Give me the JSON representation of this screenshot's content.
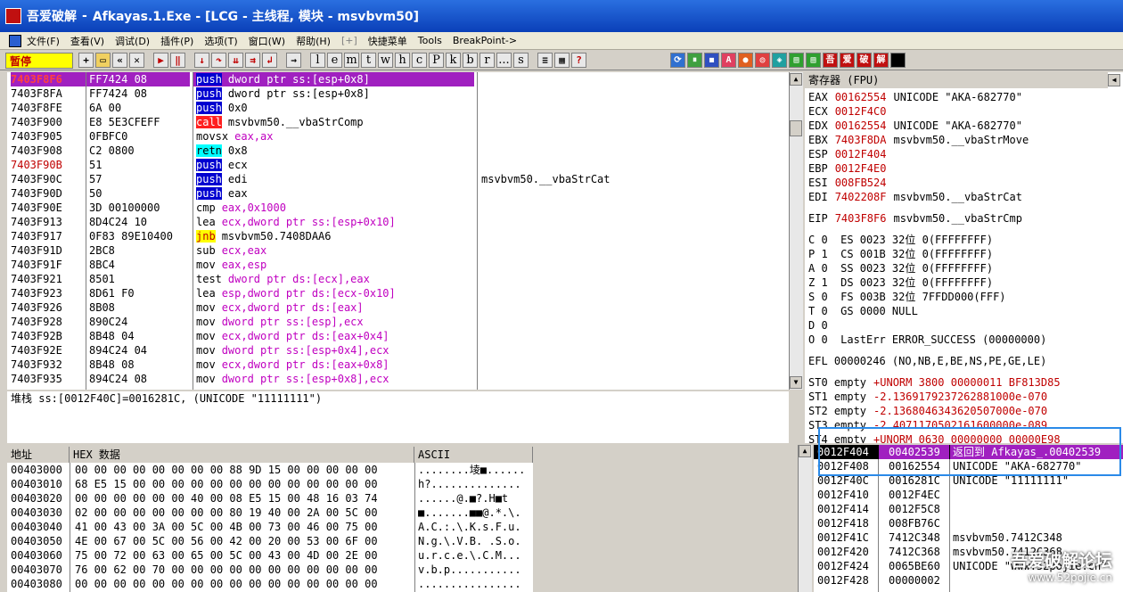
{
  "window": {
    "app_label": "吾爱破解",
    "title": "Afkayas.1.Exe - [LCG - 主线程, 模块 - msvbvm50]"
  },
  "menu": [
    "文件(F)",
    "查看(V)",
    "调试(D)",
    "插件(P)",
    "选项(T)",
    "窗口(W)",
    "帮助(H)",
    "[+]",
    "快捷菜单",
    "Tools",
    "BreakPoint->"
  ],
  "toolbar": {
    "status": "暂停",
    "letters": [
      "l",
      "e",
      "m",
      "t",
      "w",
      "h",
      "c",
      "P",
      "k",
      "b",
      "r",
      "...",
      "s"
    ],
    "right_labels": [
      "吾",
      "爱",
      "破",
      "解"
    ]
  },
  "disasm": [
    {
      "addr": "7403F8F6",
      "hex": "FF7424 08",
      "op": "push",
      "args": "dword ptr ss:[esp+0x8]",
      "cmt": "",
      "selected": true
    },
    {
      "addr": "7403F8FA",
      "hex": "FF7424 08",
      "op": "push",
      "args": "dword ptr ss:[esp+0x8]",
      "cmt": ""
    },
    {
      "addr": "7403F8FE",
      "hex": "6A 00",
      "op": "push",
      "args": "0x0",
      "cmt": ""
    },
    {
      "addr": "7403F900",
      "hex": "E8 5E3CFEFF",
      "op": "call",
      "args": "msvbvm50.__vbaStrComp",
      "cmt": ""
    },
    {
      "addr": "7403F905",
      "hex": "0FBFC0",
      "op": "movsx",
      "args": "eax,ax",
      "cmt": ""
    },
    {
      "addr": "7403F908",
      "hex": "C2 0800",
      "op": "retn",
      "args": "0x8",
      "cmt": ""
    },
    {
      "addr": "7403F90B",
      "hex": "51",
      "op": "push",
      "args": "ecx",
      "cmt": "",
      "redaddr": true
    },
    {
      "addr": "7403F90C",
      "hex": "57",
      "op": "push",
      "args": "edi",
      "cmt": "msvbvm50.__vbaStrCat"
    },
    {
      "addr": "7403F90D",
      "hex": "50",
      "op": "push",
      "args": "eax",
      "cmt": ""
    },
    {
      "addr": "7403F90E",
      "hex": "3D 00100000",
      "op": "cmp",
      "args": "eax,0x1000",
      "cmt": ""
    },
    {
      "addr": "7403F913",
      "hex": "8D4C24 10",
      "op": "lea",
      "args": "ecx,dword ptr ss:[esp+0x10]",
      "cmt": ""
    },
    {
      "addr": "7403F917",
      "hex": "0F83 89E10400",
      "op": "jnb",
      "args": "msvbvm50.7408DAA6",
      "cmt": ""
    },
    {
      "addr": "7403F91D",
      "hex": "2BC8",
      "op": "sub",
      "args": "ecx,eax",
      "cmt": ""
    },
    {
      "addr": "7403F91F",
      "hex": "8BC4",
      "op": "mov",
      "args": "eax,esp",
      "cmt": ""
    },
    {
      "addr": "7403F921",
      "hex": "8501",
      "op": "test",
      "args": "dword ptr ds:[ecx],eax",
      "cmt": ""
    },
    {
      "addr": "7403F923",
      "hex": "8D61 F0",
      "op": "lea",
      "args": "esp,dword ptr ds:[ecx-0x10]",
      "cmt": ""
    },
    {
      "addr": "7403F926",
      "hex": "8B08",
      "op": "mov",
      "args": "ecx,dword ptr ds:[eax]",
      "cmt": ""
    },
    {
      "addr": "7403F928",
      "hex": "890C24",
      "op": "mov",
      "args": "dword ptr ss:[esp],ecx",
      "cmt": ""
    },
    {
      "addr": "7403F92B",
      "hex": "8B48 04",
      "op": "mov",
      "args": "ecx,dword ptr ds:[eax+0x4]",
      "cmt": ""
    },
    {
      "addr": "7403F92E",
      "hex": "894C24 04",
      "op": "mov",
      "args": "dword ptr ss:[esp+0x4],ecx",
      "cmt": ""
    },
    {
      "addr": "7403F932",
      "hex": "8B48 08",
      "op": "mov",
      "args": "ecx,dword ptr ds:[eax+0x8]",
      "cmt": ""
    },
    {
      "addr": "7403F935",
      "hex": "894C24 08",
      "op": "mov",
      "args": "dword ptr ss:[esp+0x8],ecx",
      "cmt": ""
    }
  ],
  "info_line": "堆栈 ss:[0012F40C]=0016281C, (UNICODE \"11111111\")",
  "dump": {
    "headers": [
      "地址",
      "HEX 数据",
      "ASCII"
    ],
    "rows": [
      {
        "addr": "00403000",
        "hex": "00 00 00 00 00 00 00 00 88 9D 15 00 00 00 00 00",
        "ascii": "........堎■......"
      },
      {
        "addr": "00403010",
        "hex": "68 E5 15 00 00 00 00 00 00 00 00 00 00 00 00 00",
        "ascii": "h?.............."
      },
      {
        "addr": "00403020",
        "hex": "00 00 00 00 00 00 40 00 08 E5 15 00 48 16 03 74",
        "ascii": "......@.■?.H■t"
      },
      {
        "addr": "00403030",
        "hex": "02 00 00 00 00 00 00 00 80 19 40 00 2A 00 5C 00",
        "ascii": "■.......■■@.*.\\."
      },
      {
        "addr": "00403040",
        "hex": "41 00 43 00 3A 00 5C 00 4B 00 73 00 46 00 75 00",
        "ascii": "A.C.:.\\.K.s.F.u."
      },
      {
        "addr": "00403050",
        "hex": "4E 00 67 00 5C 00 56 00 42 00 20 00 53 00 6F 00",
        "ascii": "N.g.\\.V.B. .S.o."
      },
      {
        "addr": "00403060",
        "hex": "75 00 72 00 63 00 65 00 5C 00 43 00 4D 00 2E 00",
        "ascii": "u.r.c.e.\\.C.M..."
      },
      {
        "addr": "00403070",
        "hex": "76 00 62 00 70 00 00 00 00 00 00 00 00 00 00 00",
        "ascii": "v.b.p..........."
      },
      {
        "addr": "00403080",
        "hex": "00 00 00 00 00 00 00 00 00 00 00 00 00 00 00 00",
        "ascii": "................"
      }
    ]
  },
  "registers": {
    "header": "寄存器 (FPU)",
    "gpr": [
      {
        "name": "EAX",
        "val": "00162554",
        "desc": "UNICODE \"AKA-682770\""
      },
      {
        "name": "ECX",
        "val": "0012F4C0",
        "desc": ""
      },
      {
        "name": "EDX",
        "val": "00162554",
        "desc": "UNICODE \"AKA-682770\""
      },
      {
        "name": "EBX",
        "val": "7403F8DA",
        "desc": "msvbvm50.__vbaStrMove"
      },
      {
        "name": "ESP",
        "val": "0012F404",
        "desc": ""
      },
      {
        "name": "EBP",
        "val": "0012F4E0",
        "desc": ""
      },
      {
        "name": "ESI",
        "val": "008FB524",
        "desc": ""
      },
      {
        "name": "EDI",
        "val": "7402208F",
        "desc": "msvbvm50.__vbaStrCat"
      }
    ],
    "eip": {
      "name": "EIP",
      "val": "7403F8F6",
      "desc": "msvbvm50.__vbaStrCmp"
    },
    "flags": [
      "C 0  ES 0023 32位 0(FFFFFFFF)",
      "P 1  CS 001B 32位 0(FFFFFFFF)",
      "A 0  SS 0023 32位 0(FFFFFFFF)",
      "Z 1  DS 0023 32位 0(FFFFFFFF)",
      "S 0  FS 003B 32位 7FFDD000(FFF)",
      "T 0  GS 0000 NULL",
      "D 0",
      "O 0  LastErr ERROR_SUCCESS (00000000)"
    ],
    "efl": "EFL 00000246 (NO,NB,E,BE,NS,PE,GE,LE)",
    "fpu": [
      {
        "name": "ST0 empty",
        "val": "+UNORM 3800 00000011 BF813D85"
      },
      {
        "name": "ST1 empty",
        "val": "-2.1369179237262881000e-070"
      },
      {
        "name": "ST2 empty",
        "val": "-2.1368046343620507000e-070"
      },
      {
        "name": "ST3 empty",
        "val": "-2.4071170502161600000e-089"
      },
      {
        "name": "ST4 empty",
        "val": "+UNORM 0630 00000000 00000E98"
      }
    ]
  },
  "stack": [
    {
      "addr": "0012F404",
      "val": "00402539",
      "cmt": "返回到 Afkayas_.00402539"
    },
    {
      "addr": "0012F408",
      "val": "00162554",
      "cmt": "UNICODE \"AKA-682770\""
    },
    {
      "addr": "0012F40C",
      "val": "0016281C",
      "cmt": "UNICODE \"11111111\""
    },
    {
      "addr": "0012F410",
      "val": "0012F4EC",
      "cmt": ""
    },
    {
      "addr": "0012F414",
      "val": "0012F5C8",
      "cmt": ""
    },
    {
      "addr": "0012F418",
      "val": "008FB76C",
      "cmt": ""
    },
    {
      "addr": "0012F41C",
      "val": "7412C348",
      "cmt": "msvbvm50.7412C348"
    },
    {
      "addr": "0012F420",
      "val": "7412C368",
      "cmt": "msvbvm50.7412C368"
    },
    {
      "addr": "0012F424",
      "val": "0065BE60",
      "cmt": "UNICODE \"www.52pojie.cn\""
    },
    {
      "addr": "0012F428",
      "val": "00000002",
      "cmt": ""
    }
  ],
  "watermark": {
    "line1": "吾爱破解论坛",
    "line2": "www.52pojie.cn"
  },
  "colors": {
    "selection": "#a020c0",
    "red": "#c00000",
    "highlight_box": "#2a8ae8"
  }
}
